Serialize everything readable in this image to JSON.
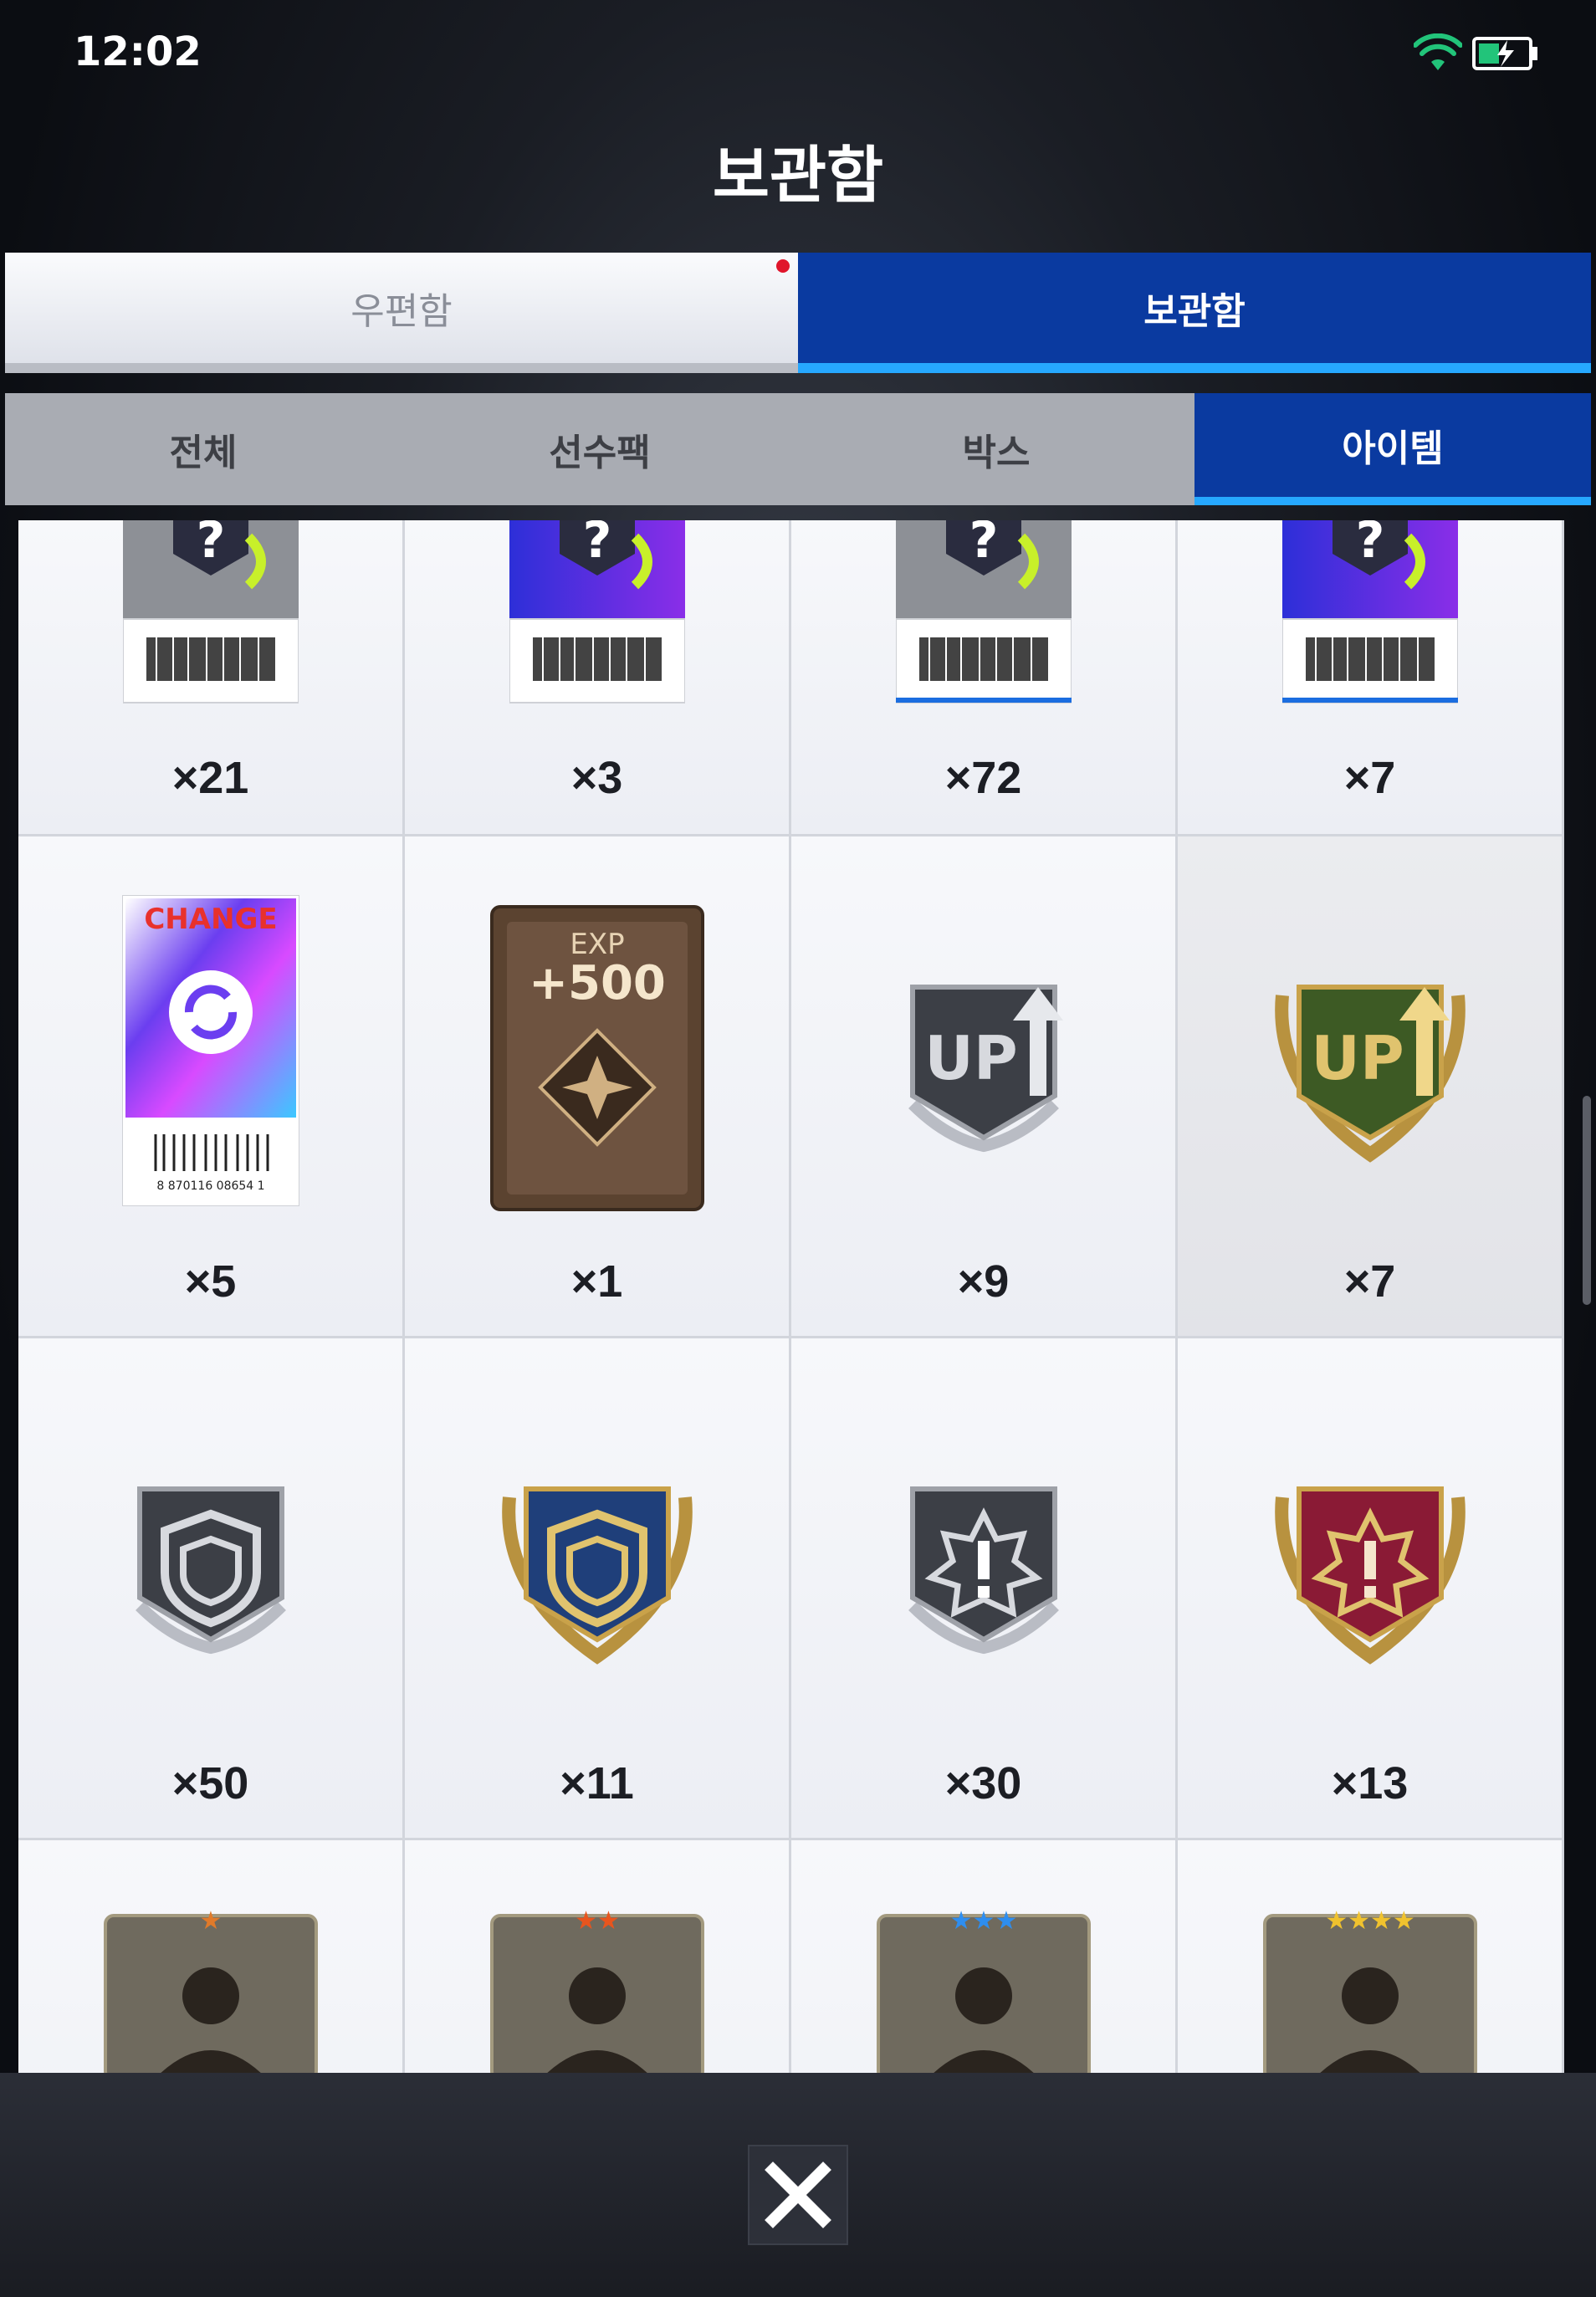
{
  "status_bar": {
    "time": "12:02",
    "wifi_icon": "wifi-icon",
    "battery_icon": "battery-charging-icon"
  },
  "title": "보관함",
  "top_tabs": [
    {
      "label": "우편함",
      "active": false,
      "has_notification": true
    },
    {
      "label": "보관함",
      "active": true
    }
  ],
  "sub_tabs": [
    {
      "label": "전체",
      "active": false
    },
    {
      "label": "선수팩",
      "active": false
    },
    {
      "label": "박스",
      "active": false
    },
    {
      "label": "아이템",
      "active": true
    }
  ],
  "items": [
    {
      "icon": "mystery-ticket-silver-icon",
      "count": "×21"
    },
    {
      "icon": "mystery-ticket-purple-icon",
      "count": "×3"
    },
    {
      "icon": "mystery-ticket-silver-icon",
      "count": "×72"
    },
    {
      "icon": "mystery-ticket-purple-icon",
      "count": "×7"
    },
    {
      "icon": "change-card-icon",
      "count": "×5",
      "card_text": "CHANGE",
      "barcode_text": "8 870116 08654 1"
    },
    {
      "icon": "exp-card-icon",
      "count": "×1",
      "card_label": "EXP",
      "card_value": "+500"
    },
    {
      "icon": "upgrade-badge-silver-icon",
      "count": "×9",
      "badge_text": "UP"
    },
    {
      "icon": "upgrade-badge-gold-icon",
      "count": "×7",
      "badge_text": "UP"
    },
    {
      "icon": "shield-badge-silver-icon",
      "count": "×50"
    },
    {
      "icon": "shield-badge-gold-icon",
      "count": "×11"
    },
    {
      "icon": "alert-badge-silver-icon",
      "count": "×30"
    },
    {
      "icon": "alert-badge-gold-icon",
      "count": "×13"
    },
    {
      "icon": "player-card-1star-icon",
      "stars": 1
    },
    {
      "icon": "player-card-2star-icon",
      "stars": 2
    },
    {
      "icon": "player-card-3star-icon",
      "stars": 3
    },
    {
      "icon": "player-card-4star-icon",
      "stars": 4
    }
  ],
  "close_button": {
    "icon": "close-icon"
  },
  "colors": {
    "accent": "#0a3aa0",
    "accent_line": "#26a8ff",
    "notification": "#e0152b"
  }
}
